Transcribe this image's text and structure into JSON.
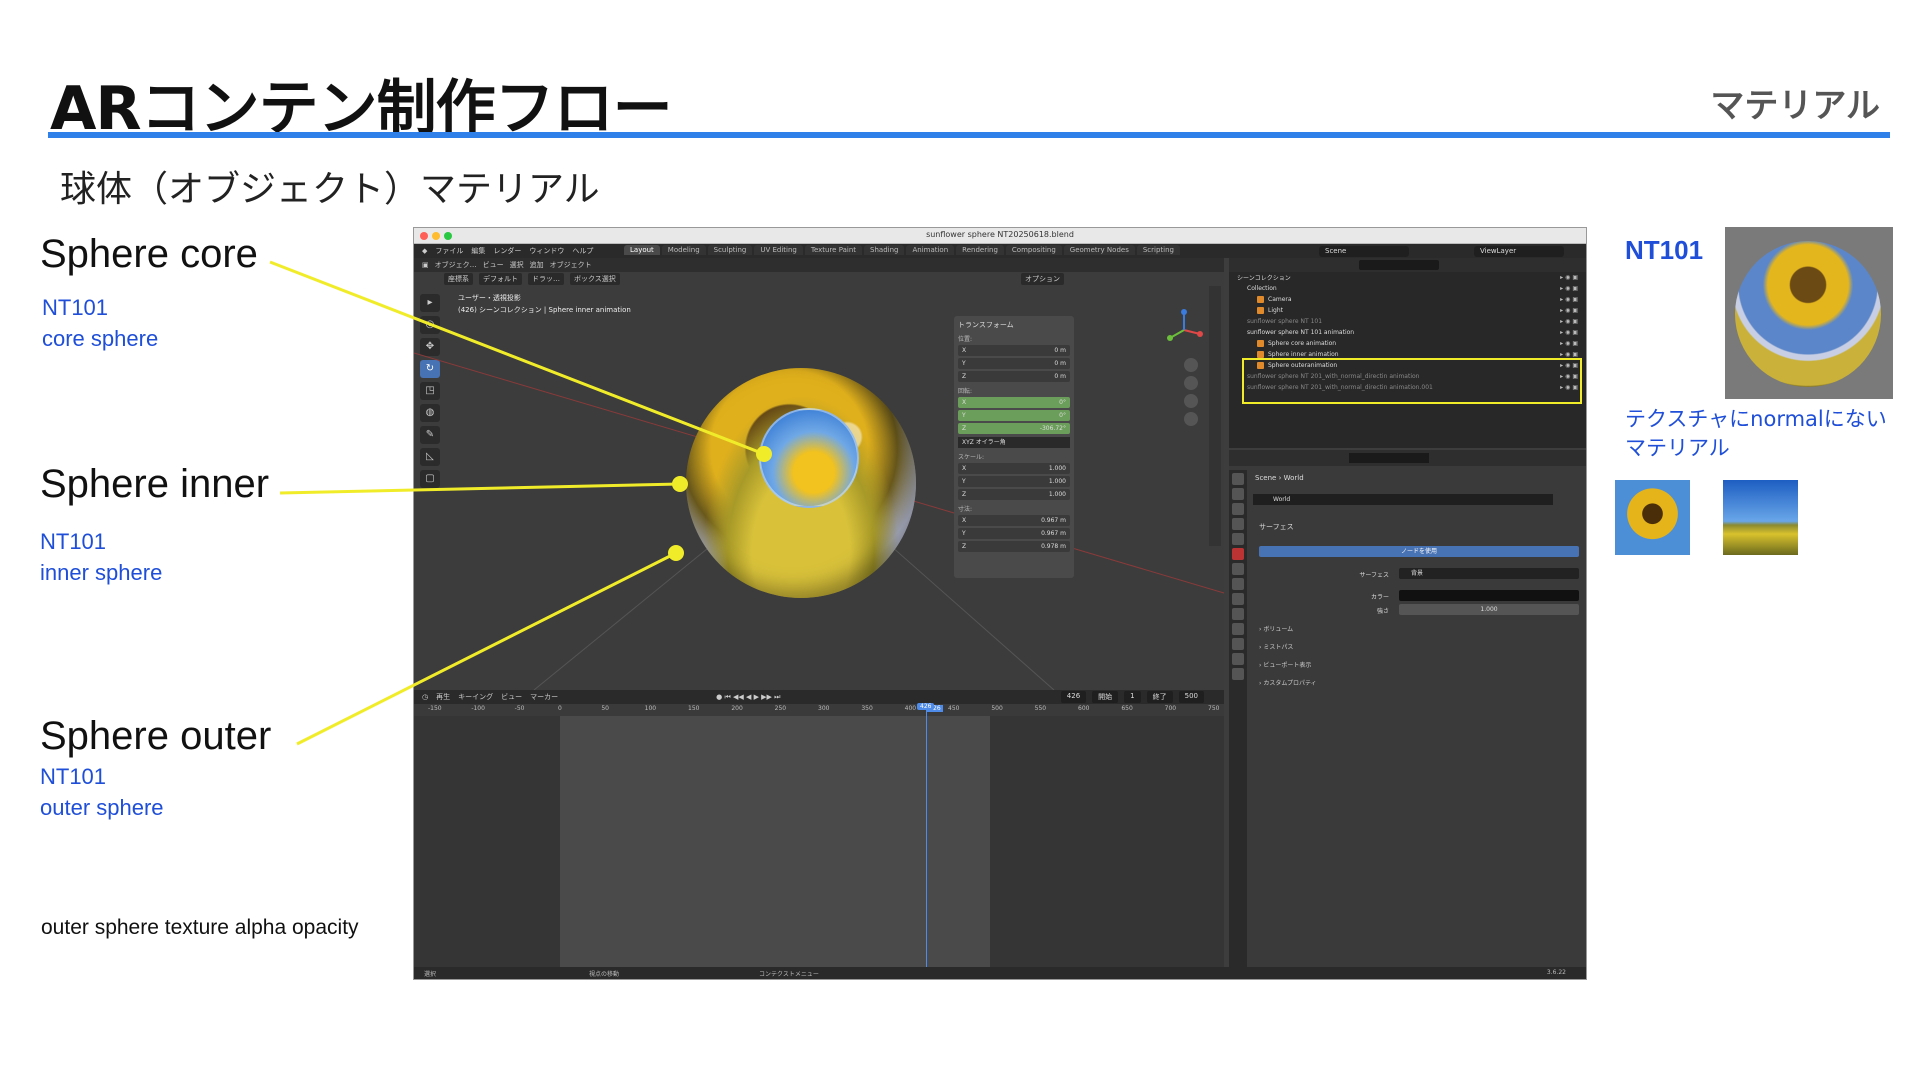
{
  "slide": {
    "title": "ARコンテン制作フロー",
    "tag": "マテリアル",
    "subtitle": "球体（オブジェクト）マテリアル"
  },
  "labels": {
    "core": {
      "title": "Sphere core",
      "line1": "NT101",
      "line2": "core sphere"
    },
    "inner": {
      "title": "Sphere inner",
      "line1": "NT101",
      "line2": "inner sphere"
    },
    "outer": {
      "title": "Sphere outer",
      "line1": "NT101",
      "line2": "outer sphere"
    },
    "opacity_note": "outer sphere texture alpha opacity"
  },
  "blender": {
    "window_title": "sunflower sphere NT20250618.blend",
    "menu": [
      "ファイル",
      "編集",
      "レンダー",
      "ウィンドウ",
      "ヘルプ"
    ],
    "workspaces": [
      "Layout",
      "Modeling",
      "Sculpting",
      "UV Editing",
      "Texture Paint",
      "Shading",
      "Animation",
      "Rendering",
      "Compositing",
      "Geometry Nodes",
      "Scripting"
    ],
    "active_workspace": "Layout",
    "scene": "Scene",
    "view_layer": "ViewLayer",
    "viewport": {
      "header": [
        "オブジェク…",
        "ビュー",
        "選択",
        "追加",
        "オブジェクト"
      ],
      "sub": [
        "座標系",
        "デフォルト",
        "ドラッ…",
        "ボックス選択"
      ],
      "options": "オプション",
      "info_line1": "ユーザー・透視投影",
      "info_line2": "(426) シーンコレクション | Sphere inner animation"
    },
    "n_panel": {
      "title": "トランスフォーム",
      "location_label": "位置:",
      "location": [
        {
          "axis": "X",
          "value": "0 m"
        },
        {
          "axis": "Y",
          "value": "0 m"
        },
        {
          "axis": "Z",
          "value": "0 m"
        }
      ],
      "rotation_label": "回転:",
      "rotation": [
        {
          "axis": "X",
          "value": "0°"
        },
        {
          "axis": "Y",
          "value": "0°"
        },
        {
          "axis": "Z",
          "value": "-306.72°"
        }
      ],
      "rotation_mode": "XYZ オイラー角",
      "scale_label": "スケール:",
      "scale": [
        {
          "axis": "X",
          "value": "1.000"
        },
        {
          "axis": "Y",
          "value": "1.000"
        },
        {
          "axis": "Z",
          "value": "1.000"
        }
      ],
      "dimensions_label": "寸法:",
      "dimensions": [
        {
          "axis": "X",
          "value": "0.967 m"
        },
        {
          "axis": "Y",
          "value": "0.967 m"
        },
        {
          "axis": "Z",
          "value": "0.978 m"
        }
      ]
    },
    "timeline": {
      "header": [
        "再生",
        "キーイング",
        "ビュー",
        "マーカー"
      ],
      "current_frame": "426",
      "start_label": "開始",
      "start": "1",
      "end_label": "終了",
      "end": "500",
      "ticks": [
        "-150",
        "-100",
        "-50",
        "0",
        "50",
        "100",
        "150",
        "200",
        "250",
        "300",
        "350",
        "400",
        "426",
        "450",
        "500",
        "550",
        "600",
        "650",
        "700",
        "750"
      ]
    },
    "outliner": {
      "rows": [
        {
          "name": "シーンコレクション",
          "dim": false
        },
        {
          "name": "Collection",
          "dim": false
        },
        {
          "name": "Camera",
          "dim": false
        },
        {
          "name": "Light",
          "dim": false
        },
        {
          "name": "sunflower sphere NT 101",
          "dim": true
        },
        {
          "name": "sunflower sphere NT 101 animation",
          "dim": false
        },
        {
          "name": "Sphere core animation",
          "dim": false
        },
        {
          "name": "Sphere inner animation",
          "dim": false
        },
        {
          "name": "Sphere outeranimation",
          "dim": false
        },
        {
          "name": "sunflower sphere NT 201_with_normal_directin animation",
          "dim": true
        },
        {
          "name": "sunflower sphere NT 201_with_normal_directin animation.001",
          "dim": true
        }
      ]
    },
    "properties": {
      "breadcrumb_scene": "Scene",
      "breadcrumb_world": "World",
      "world_name": "World",
      "surface_section": "サーフェス",
      "use_nodes": "ノードを使用",
      "surface_label": "サーフェス",
      "surface_value": "背景",
      "color_label": "カラー",
      "strength_label": "強さ",
      "strength_value": "1.000",
      "collapsed": [
        "ボリューム",
        "ミストパス",
        "ビューポート表示",
        "カスタムプロパティ"
      ]
    },
    "status": {
      "select": "選択",
      "rotate": "視点の移動",
      "context": "コンテクストメニュー",
      "version": "3.6.22"
    }
  },
  "preview": {
    "title": "NT101",
    "note_line1": "テクスチャにnormalにない",
    "note_line2": "マテリアル"
  },
  "colors": {
    "accent": "#2f80e8",
    "note_blue": "#1f4fd8",
    "leader": "#f1ec2a"
  }
}
